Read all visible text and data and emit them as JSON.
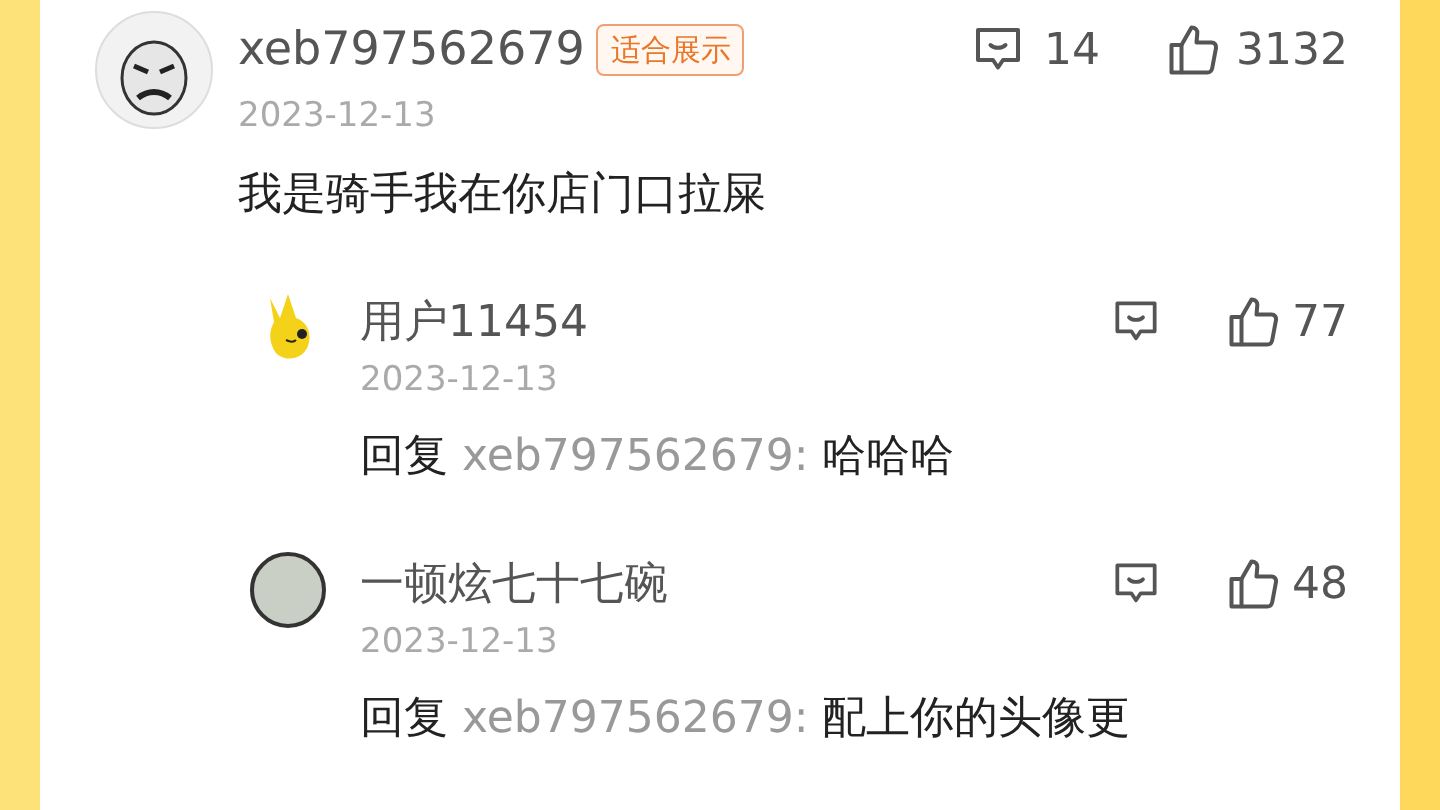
{
  "comment": {
    "username": "xeb797562679",
    "badge": "适合展示",
    "date": "2023-12-13",
    "text": "我是骑手我在你店门口拉屎",
    "reply_count": "14",
    "like_count": "3132"
  },
  "replies": [
    {
      "username": "用户11454",
      "date": "2023-12-13",
      "reply_label": "回复",
      "reply_to": "xeb797562679:",
      "text": "哈哈哈",
      "like_count": "77"
    },
    {
      "username": "一顿炫七十七碗",
      "date": "2023-12-13",
      "reply_label": "回复",
      "reply_to": "xeb797562679:",
      "text": "配上你的头像更",
      "like_count": "48"
    }
  ]
}
